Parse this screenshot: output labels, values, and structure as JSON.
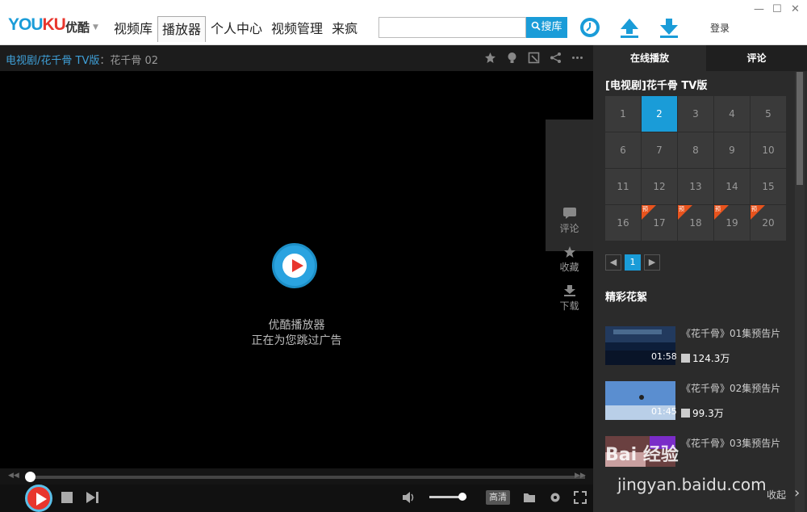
{
  "header": {
    "logo_text_1": "YOU",
    "logo_text_2": "KU",
    "logo_sub": "优酷",
    "nav": [
      "视频库",
      "播放器",
      "个人中心",
      "视频管理",
      "来疯"
    ],
    "active_nav": "播放器",
    "search_value": "",
    "search_button": "搜库",
    "login": "登录",
    "icons": [
      "clock-icon",
      "upload-icon",
      "download-icon"
    ],
    "accent": "#1a9cd8"
  },
  "breadcrumb": {
    "link": "电视剧/花千骨 TV版",
    "sep": "：",
    "current": "花千骨 02"
  },
  "player": {
    "title": "优酷播放器",
    "subtitle": "正在为您跳过广告",
    "side_tools": [
      "评论",
      "收藏",
      "下载"
    ],
    "quality": "高清",
    "progress": 0.0,
    "volume": 0.8
  },
  "panel": {
    "tabs": [
      "在线播放",
      "评论"
    ],
    "series_title": "[电视剧]花千骨 TV版",
    "episodes": [
      "1",
      "2",
      "3",
      "4",
      "5",
      "6",
      "7",
      "8",
      "9",
      "10",
      "11",
      "12",
      "13",
      "14",
      "15",
      "16",
      "17",
      "18",
      "19",
      "20"
    ],
    "active_episode": "2",
    "preview_badge": "预",
    "preview_episodes": [
      "17",
      "18",
      "19",
      "20"
    ],
    "page": "1",
    "clips_title": "精彩花絮",
    "clips": [
      {
        "title": "《花千骨》01集预告片",
        "duration": "01:58",
        "views": "124.3万"
      },
      {
        "title": "《花千骨》02集预告片",
        "duration": "01:45",
        "views": "99.3万"
      },
      {
        "title": "《花千骨》03集预告片",
        "duration": "",
        "views": ""
      }
    ],
    "collapse": "收起"
  },
  "watermark": {
    "main": "Bai 经验",
    "sub": "jingyan.baidu.com"
  }
}
